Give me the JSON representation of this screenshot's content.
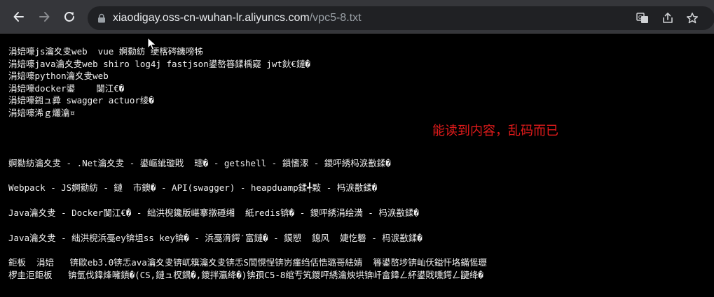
{
  "browser": {
    "url_host": "xiaodigay.oss-cn-wuhan-lr.aliyuncs.com",
    "url_path": "/vpc5-8.txt",
    "icons": {
      "back": "arrow-left-icon",
      "forward": "arrow-right-icon",
      "reload": "reload-icon",
      "lock": "lock-icon",
      "translate": "translate-icon",
      "share": "share-icon",
      "bookmark": "star-icon"
    }
  },
  "document": {
    "block1": [
      "涓婄嚎js瀹夊叏web  vue 婀勬紡 绠楁硶鐖嗙牬",
      "涓婄嚎java瀹夊叏web shiro log4j fastjson鍙嶅簭鍒楀寲 jwt鈥€鏈�",
      "涓婄嚎python瀹夊叏web",
      "涓婄嚎docker鍙    闅江€�",
      "涓婄嚎鎺ュ彛 swagger actuor绫�",
      "涓婄嚎浠ｇ爜瀹¤"
    ],
    "block2": [
      "婀勬紡瀹夊叏 - .Net瀹夊叏 - 鍙嶇紪璇戝  璁� - getshell - 鎻愭潈 - 鍐呯綉杩涙敾鍒�",
      "Webpack - JS婀勬紡 - 鏈  市鐭� - API(swagger) - heapduamp鍒╃敤 - 杩涙敾鍒�",
      "Java瀹夊叏 - Docker闅江€� - 绌洪棿鑱版嵁搴撴硾缃  紙redis锛� - 鍐呯綉涓绘満 - 杩涙敾鍒�",
      "Java瀹夊叏 - 绌洪棿浜戞ey锛坥ss key锛� - 浜戞湇鍔′富鏈� - 鏌愬  鎴风  婕忔礊 - 杩涙敾鍒�",
      "鉅板  涓婄   锛歐eb3.0锛忎ava瀹夊叏锛屼簯瀹夊叏锛忎S闆愰悜锛岃瘽绉佸悎璐哥紶婧  簭鍙嶅埗锛屾仸鎰忓垎鏋愮瓑",
      "椤圭洰鉅板   锛氫伐鍏烽噰鎻�(CS,鏈ュ杈鍝�,鍐拌瀛绛�)锛孭C5-8绾亐笂鍐呯綉瀹炴垬锛屽畣鍏ㄥ紑鍙戝嚑鍔ㄥ疀绛�"
    ],
    "annotation": "能读到内容，乱码而已"
  }
}
